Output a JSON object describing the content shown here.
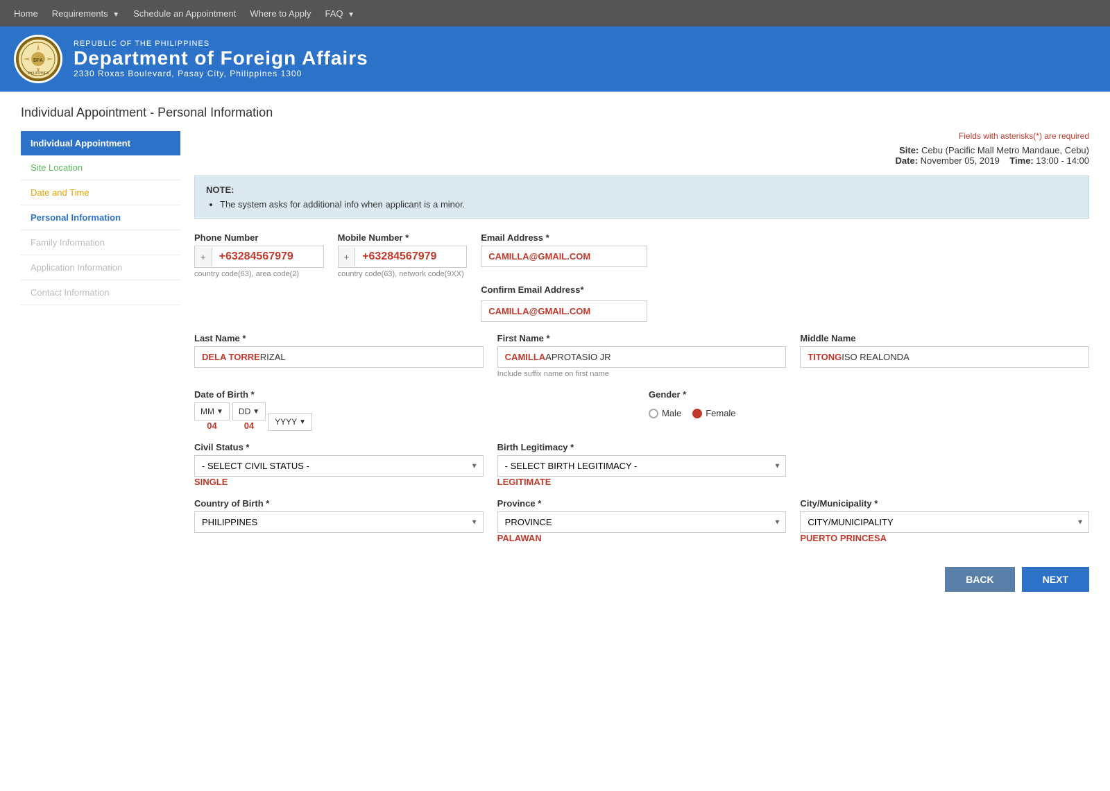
{
  "nav": {
    "items": [
      {
        "label": "Home",
        "dropdown": false
      },
      {
        "label": "Requirements",
        "dropdown": true
      },
      {
        "label": "Schedule an Appointment",
        "dropdown": false
      },
      {
        "label": "Where to Apply",
        "dropdown": false
      },
      {
        "label": "FAQ",
        "dropdown": true
      }
    ]
  },
  "header": {
    "republic": "Republic of the Philippines",
    "dept": "Department of Foreign Affairs",
    "address": "2330 Roxas Boulevard, Pasay City, Philippines 1300"
  },
  "page_title": "Individual Appointment - Personal Information",
  "sidebar": {
    "header_label": "Individual Appointment",
    "items": [
      {
        "label": "Site Location",
        "state": "green"
      },
      {
        "label": "Date and Time",
        "state": "orange"
      },
      {
        "label": "Personal Information",
        "state": "active"
      },
      {
        "label": "Family Information",
        "state": "disabled"
      },
      {
        "label": "Application Information",
        "state": "disabled"
      },
      {
        "label": "Contact Information",
        "state": "disabled"
      }
    ]
  },
  "form": {
    "required_note": "Fields with asterisks(*) are required",
    "site_label": "Site:",
    "site_value": "Cebu (Pacific Mall Metro Mandaue, Cebu)",
    "date_label": "Date:",
    "date_value": "November 05, 2019",
    "time_label": "Time:",
    "time_value": "13:00 - 14:00",
    "note_title": "NOTE:",
    "note_bullet": "The system asks for additional info when applicant is a minor.",
    "phone_label": "Phone Number",
    "phone_prefix": "+",
    "phone_value": "+63284567979",
    "phone_hint": "country code(63), area code(2)",
    "mobile_label": "Mobile Number *",
    "mobile_prefix": "+",
    "mobile_value": "+63284567979",
    "mobile_hint": "country code(63), network code(9XX)",
    "email_label": "Email Address *",
    "email_value": "CAMILLA@GMAIL.COM",
    "confirm_email_label": "Confirm Email Address*",
    "confirm_email_value": "CAMILLA@GMAIL.COM",
    "last_name_label": "Last Name *",
    "last_name_value": "DELA TORRE",
    "last_name_suffix": "RIZAL",
    "first_name_label": "First Name *",
    "first_name_value": "CAMILLA",
    "first_name_suffix": "APROTASIO JR",
    "first_name_hint": "Include suffix name on first name",
    "middle_name_label": "Middle Name",
    "middle_name_value": "TITONG",
    "middle_name_suffix": "ISO REALONDA",
    "dob_label": "Date of Birth *",
    "dob_mm_label": "MM",
    "dob_mm_value": "04",
    "dob_dd_label": "DD",
    "dob_dd_value": "04",
    "dob_yyyy_label": "YYYY",
    "gender_label": "Gender *",
    "gender_male": "Male",
    "gender_female": "Female",
    "gender_selected": "Female",
    "civil_status_label": "Civil Status *",
    "civil_status_default": "- SELECT CIVIL STATUS -",
    "civil_status_value": "SINGLE",
    "birth_legit_label": "Birth Legitimacy *",
    "birth_legit_default": "- SELECT BIRTH LEGITIMACY -",
    "birth_legit_value": "LEGITIMATE",
    "country_birth_label": "Country of Birth *",
    "country_birth_value": "PHILIPPINES",
    "province_label": "Province *",
    "province_default": "PROVINCE",
    "province_value": "PALAWAN",
    "city_label": "City/Municipality *",
    "city_default": "CITY/MUNICIPALITY",
    "city_value": "PUERTO PRINCESA",
    "btn_back": "BACK",
    "btn_next": "NEXT"
  }
}
